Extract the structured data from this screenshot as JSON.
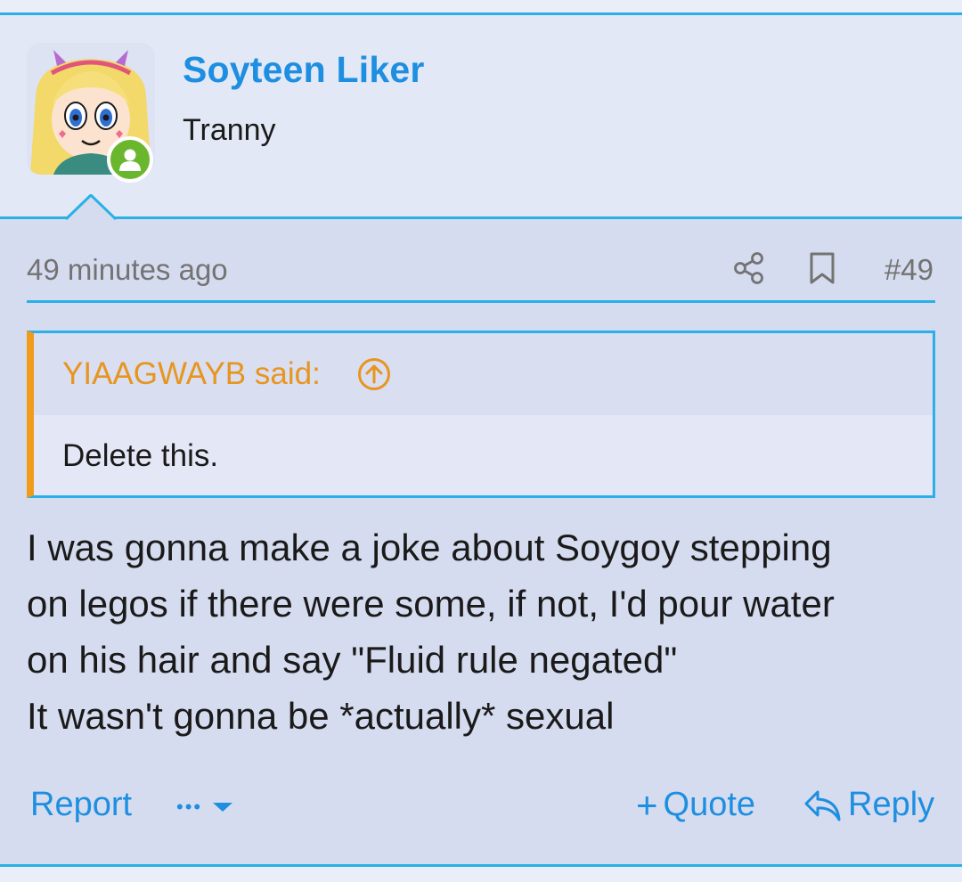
{
  "user": {
    "name": "Soyteen Liker",
    "title": "Tranny",
    "avatar_icon": "cartoon-avatar",
    "status_icon": "online-user-icon"
  },
  "post": {
    "time": "49 minutes ago",
    "number": "#49",
    "share_icon": "share-icon",
    "bookmark_icon": "bookmark-icon"
  },
  "quote": {
    "author_label": "YIAAGWAYB said:",
    "text": "Delete this.",
    "jump_icon": "arrow-up-circle-icon"
  },
  "message": {
    "lines": [
      "I was gonna make a joke about Soygoy stepping",
      "on legos if there were some, if not, I'd pour water",
      "on his hair and say \"Fluid rule negated\"",
      "It wasn't gonna be *actually* sexual"
    ]
  },
  "actions": {
    "report": "Report",
    "more": "•••",
    "quote": "Quote",
    "reply": "Reply"
  },
  "colors": {
    "accent": "#1e8fe0",
    "border": "#2ab0e6",
    "quote_author": "#e8951e",
    "quote_bar": "#f09b1a",
    "online": "#6ab72e"
  }
}
